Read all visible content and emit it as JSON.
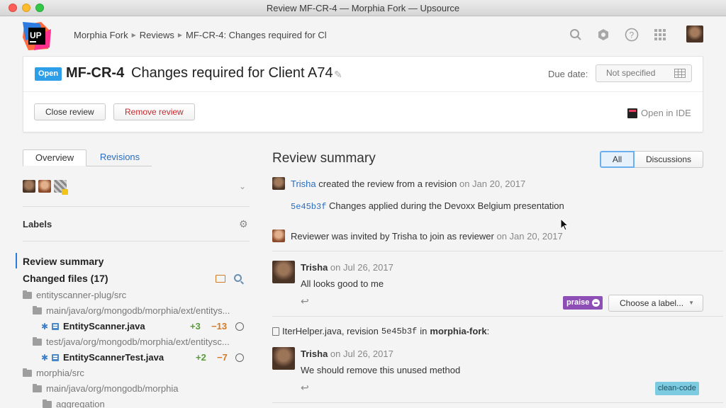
{
  "window": {
    "title": "Review MF-CR-4 — Morphia Fork — Upsource"
  },
  "header": {
    "logo_text": "UP",
    "breadcrumb": [
      "Morphia Fork",
      "Reviews",
      "MF-CR-4: Changes required for Cl"
    ]
  },
  "review": {
    "status": "Open",
    "id": "MF-CR-4",
    "title": "Changes required for Client A74",
    "due_label": "Due date:",
    "due_value": "Not specified",
    "close_label": "Close review",
    "remove_label": "Remove review",
    "open_ide_label": "Open in IDE"
  },
  "left": {
    "tabs": [
      "Overview",
      "Revisions"
    ],
    "labels_title": "Labels",
    "nav_summary": "Review summary",
    "nav_changed": "Changed files (17)",
    "tree": [
      {
        "type": "folder",
        "label": "entityscanner-plug/src"
      },
      {
        "type": "folder",
        "label": "main/java/org/mongodb/morphia/ext/entitys..."
      },
      {
        "type": "file",
        "label": "EntityScanner.java",
        "added": "+3",
        "removed": "−13"
      },
      {
        "type": "folder",
        "label": "test/java/org/mongodb/morphia/ext/entitysc..."
      },
      {
        "type": "file",
        "label": "EntityScannerTest.java",
        "added": "+2",
        "removed": "−7"
      },
      {
        "type": "folder",
        "label": "morphia/src"
      },
      {
        "type": "folder",
        "label": "main/java/org/mongodb/morphia"
      },
      {
        "type": "folder",
        "label": "aggregation"
      }
    ]
  },
  "right": {
    "title": "Review summary",
    "filter_all": "All",
    "filter_discussions": "Discussions",
    "events": [
      {
        "author": "Trisha",
        "text": "created the review from a revision",
        "date": "on Jan 20, 2017"
      },
      {
        "hash": "5e45b3f",
        "text": "Changes applied during the Devoxx Belgium presentation"
      },
      {
        "text": "Reviewer was invited by Trisha to join as reviewer",
        "date": "on Jan 20, 2017"
      }
    ],
    "comments": [
      {
        "author": "Trisha",
        "date": "on Jul 26, 2017",
        "body": "All looks good to me",
        "label": "praise",
        "choose_label": "Choose a label..."
      },
      {
        "author": "Trisha",
        "date": "on Jul 26, 2017",
        "body": "We should remove this unused method",
        "label": "clean-code"
      }
    ],
    "file_ref": {
      "file": "IterHelper.java, revision",
      "hash": "5e45b3f",
      "in": "in",
      "repo": "morphia-fork",
      "suffix": ":"
    }
  },
  "colors": {
    "accent": "#2d9ee8",
    "danger": "#c6282d",
    "praise": "#8d4eb5",
    "clean_code": "#7dcbe0",
    "added": "#5b9a3a",
    "removed": "#d07a2a"
  }
}
